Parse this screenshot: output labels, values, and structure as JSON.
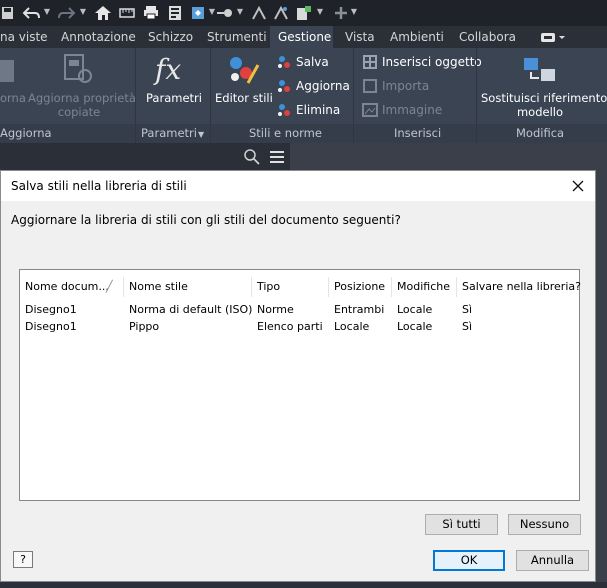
{
  "ribbon": {
    "tabs": [
      {
        "label": "na viste"
      },
      {
        "label": "Annotazione"
      },
      {
        "label": "Schizzo"
      },
      {
        "label": "Strumenti"
      },
      {
        "label": "Gestione",
        "active": true
      },
      {
        "label": "Vista"
      },
      {
        "label": "Ambienti"
      },
      {
        "label": "Collabora"
      }
    ],
    "commands": {
      "orna": "orna",
      "aggiorna_copie_line1": "Aggiorna proprietà",
      "aggiorna_copie_line2": "copiate",
      "parametri": "Parametri",
      "editor_stili": "Editor stili",
      "salva": "Salva",
      "aggiorna": "Aggiorna",
      "elimina": "Elimina",
      "inserisci_oggetto": "Inserisci oggetto",
      "importa": "Importa",
      "immagine": "Immagine",
      "sostituisci_line1": "Sostituisci riferimento",
      "sostituisci_line2": "modello"
    },
    "panels": {
      "aggiorna": "Aggiorna",
      "parametri": "Parametri",
      "stili_norme": "Stili e norme",
      "inserisci": "Inserisci",
      "modifica": "Modifica"
    }
  },
  "dialog": {
    "title": "Salva stili nella libreria di stili",
    "question": "Aggiornare la libreria di stili con gli stili del documento seguenti?",
    "columns": [
      "Nome docum...",
      "Nome stile",
      "Tipo",
      "Posizione",
      "Modifiche",
      "Salvare nella libreria?"
    ],
    "rows": [
      [
        "Disegno1",
        "Norma di default (ISO)",
        "Norme",
        "Entrambi",
        "Locale",
        "Sì"
      ],
      [
        "Disegno1",
        "Pippo",
        "Elenco parti",
        "Locale",
        "Locale",
        "Sì"
      ]
    ],
    "buttons": {
      "si_tutti": "Sì tutti",
      "nessuno": "Nessuno",
      "ok": "OK",
      "annulla": "Annulla",
      "help": "?"
    }
  },
  "colors": {
    "ribbon_bg": "#3b4453",
    "titlebar_bg": "#1f2229",
    "accent": "#0078d7"
  }
}
